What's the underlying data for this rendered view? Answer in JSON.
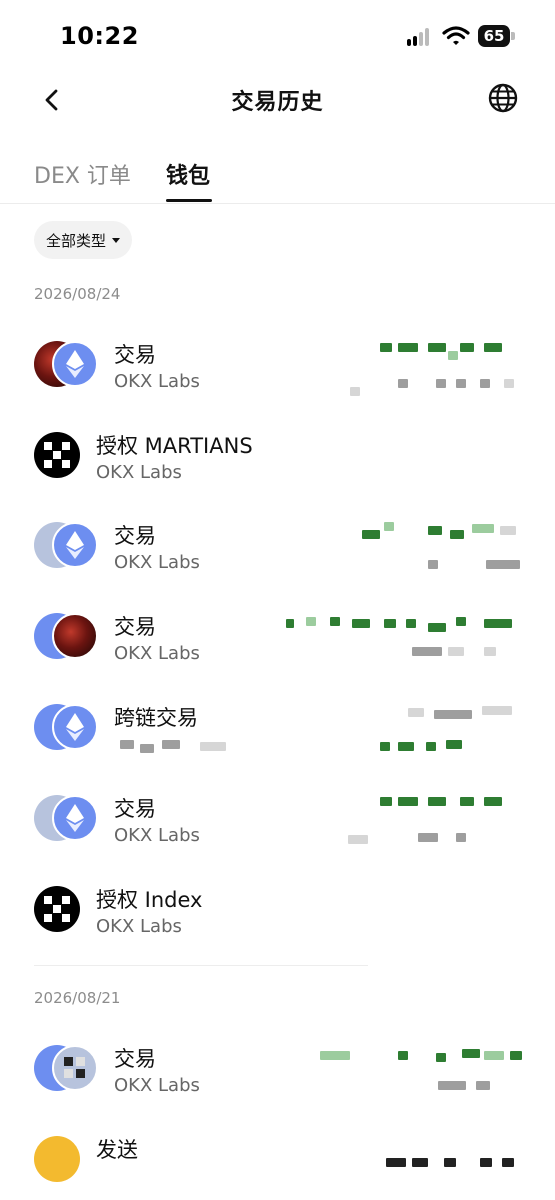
{
  "status_bar": {
    "time": "10:22",
    "battery": "65"
  },
  "header": {
    "title": "交易历史"
  },
  "tabs": [
    {
      "label": "DEX 订单",
      "active": false
    },
    {
      "label": "钱包",
      "active": true
    }
  ],
  "filter": {
    "label": "全部类型"
  },
  "groups": [
    {
      "date": "2026/08/24",
      "items": [
        {
          "title": "交易",
          "subtitle": "OKX Labs",
          "icon": "nft-eth-pair-icon"
        },
        {
          "title": "授权 MARTIANS",
          "subtitle": "OKX Labs",
          "icon": "okx-logo-icon"
        },
        {
          "title": "交易",
          "subtitle": "OKX Labs",
          "icon": "nft-eth-pair-icon"
        },
        {
          "title": "交易",
          "subtitle": "OKX Labs",
          "icon": "eth-nft-pair-icon"
        },
        {
          "title": "跨链交易",
          "subtitle": "",
          "icon": "eth-eth-pair-icon"
        },
        {
          "title": "交易",
          "subtitle": "OKX Labs",
          "icon": "nft-eth-pair-icon"
        },
        {
          "title": "授权 Index",
          "subtitle": "OKX Labs",
          "icon": "okx-logo-icon"
        }
      ]
    },
    {
      "date": "2026/08/21",
      "items": [
        {
          "title": "交易",
          "subtitle": "OKX Labs",
          "icon": "eth-nft-pair-icon"
        },
        {
          "title": "发送",
          "subtitle": "",
          "icon": "bnb-icon"
        }
      ]
    }
  ],
  "colors": {
    "accent_green": "#2e7d32",
    "eth_blue": "#6d8ef0",
    "muted_text": "#8c8c8c"
  }
}
